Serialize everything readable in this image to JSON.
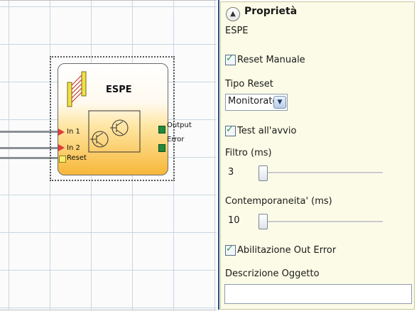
{
  "canvas": {
    "block": {
      "title": "ESPE",
      "inputs": [
        "In 1",
        "In 2",
        "Reset"
      ],
      "outputs": [
        "Output",
        "Error"
      ]
    }
  },
  "properties": {
    "collapse_icon": "chevron-up-icon",
    "title": "Proprietà",
    "object_name": "ESPE",
    "reset_manuale_label": "Reset Manuale",
    "tipo_reset_label": "Tipo Reset",
    "tipo_reset_value": "Monitorato",
    "test_avvio_label": "Test all'avvio",
    "filtro_label": "Filtro (ms)",
    "filtro_value": "3",
    "contemporaneita_label": "Contemporaneita' (ms)",
    "contemporaneita_value": "10",
    "abilitazione_label": "Abilitazione Out Error",
    "descrizione_label": "Descrizione Oggetto",
    "descrizione_value": ""
  }
}
